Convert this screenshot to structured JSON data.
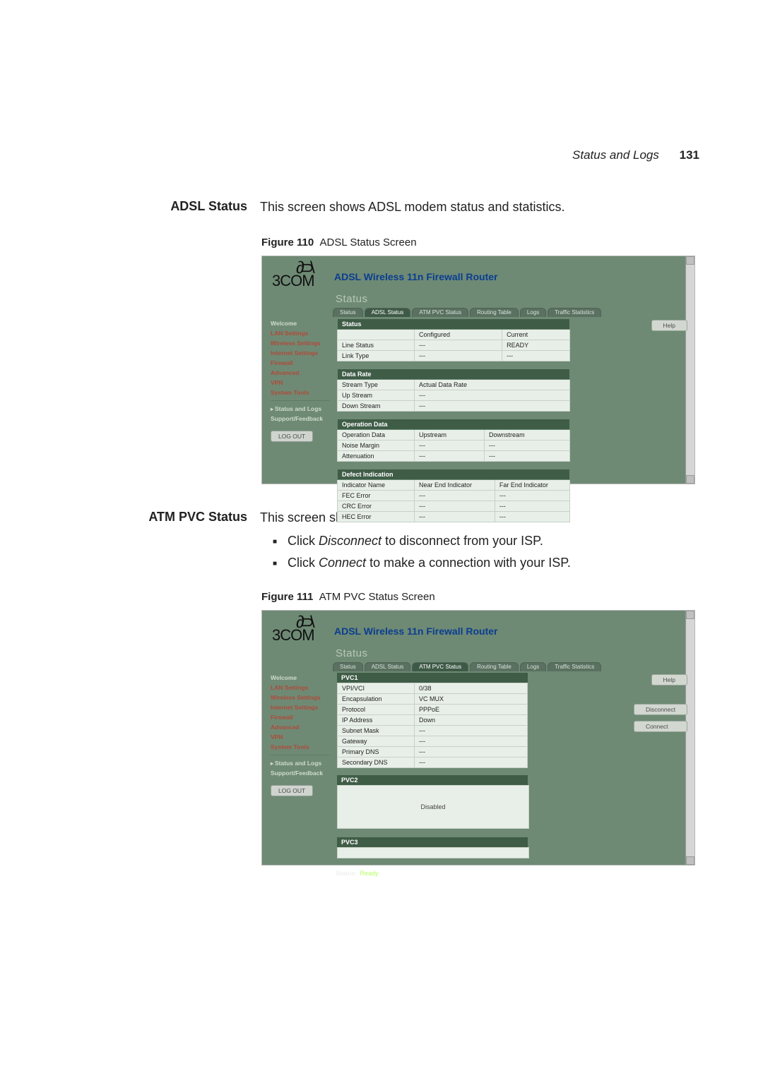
{
  "page_header": {
    "section": "Status and Logs",
    "page_number": "131"
  },
  "sections": {
    "adsl_status": {
      "heading": "ADSL Status",
      "intro": "This screen shows ADSL modem status and statistics."
    },
    "atm_pvc_status": {
      "heading": "ATM PVC Status",
      "intro": "This screen shows ATM PVC status and statistics.",
      "bullets": {
        "b1_pre": "Click ",
        "b1_em": "Disconnect",
        "b1_post": " to disconnect from your ISP.",
        "b2_pre": "Click ",
        "b2_em": "Connect",
        "b2_post": " to make a connection with your ISP."
      }
    }
  },
  "figures": {
    "f110": {
      "label": "Figure 110",
      "caption": "ADSL Status Screen"
    },
    "f111": {
      "label": "Figure 111",
      "caption": "ATM PVC Status Screen"
    }
  },
  "router_common": {
    "brand_script": "∂⊃\\",
    "brand": "3COM",
    "product": "ADSL Wireless 11n Firewall Router",
    "breadcrumb": "Status",
    "tabs": {
      "status": "Status",
      "adsl_status": "ADSL Status",
      "atm_pvc_status": "ATM PVC Status",
      "routing_table": "Routing Table",
      "logs": "Logs",
      "traffic_stats": "Traffic Statistics"
    },
    "sidebar": {
      "welcome": "Welcome",
      "lan": "LAN Settings",
      "wireless": "Wireless Settings",
      "internet": "Internet Settings",
      "firewall": "Firewall",
      "advanced": "Advanced",
      "vpn": "VPN",
      "system_tools": "System Tools",
      "status_logs": "Status and Logs",
      "support": "Support/Feedback",
      "logout": "LOG OUT"
    },
    "buttons": {
      "help": "Help",
      "disconnect": "Disconnect",
      "connect": "Connect"
    },
    "status_footer_label": "Status:",
    "status_footer_value": "Ready"
  },
  "adsl_screen": {
    "status": {
      "title": "Status",
      "h_conf": "Configured",
      "h_cur": "Current",
      "r1_k": "Line Status",
      "r1_a": "---",
      "r1_b": "READY",
      "r2_k": "Link Type",
      "r2_a": "---",
      "r2_b": "---"
    },
    "data_rate": {
      "title": "Data Rate",
      "h_a": "Actual Data Rate",
      "r1_k": "Stream Type",
      "r1_a": "",
      "r2_k": "Up Stream",
      "r2_a": "---",
      "r3_k": "Down Stream",
      "r3_a": "---"
    },
    "operation_data": {
      "title": "Operation Data",
      "h_a": "Upstream",
      "h_b": "Downstream",
      "r1_k": "Operation Data",
      "r1_a": "",
      "r1_b": "",
      "r2_k": "Noise Margin",
      "r2_a": "---",
      "r2_b": "---",
      "r3_k": "Attenuation",
      "r3_a": "---",
      "r3_b": "---"
    },
    "defect": {
      "title": "Defect Indication",
      "h_a": "Near End Indicator",
      "h_b": "Far End Indicator",
      "r1_k": "Indicator Name",
      "r1_a": "",
      "r1_b": "",
      "r2_k": "FEC Error",
      "r2_a": "---",
      "r2_b": "---",
      "r3_k": "CRC Error",
      "r3_a": "---",
      "r3_b": "---",
      "r4_k": "HEC Error",
      "r4_a": "---",
      "r4_b": "---"
    }
  },
  "atm_screen": {
    "pvc1": {
      "title": "PVC1",
      "r1_k": "VPI/VCI",
      "r1_v": "0/38",
      "r2_k": "Encapsulation",
      "r2_v": "VC MUX",
      "r3_k": "Protocol",
      "r3_v": "PPPoE",
      "r4_k": "IP Address",
      "r4_v": "Down",
      "r5_k": "Subnet Mask",
      "r5_v": "---",
      "r6_k": "Gateway",
      "r6_v": "---",
      "r7_k": "Primary DNS",
      "r7_v": "---",
      "r8_k": "Secondary DNS",
      "r8_v": "---"
    },
    "pvc2": {
      "title": "PVC2",
      "body": "Disabled"
    },
    "pvc3": {
      "title": "PVC3"
    }
  }
}
